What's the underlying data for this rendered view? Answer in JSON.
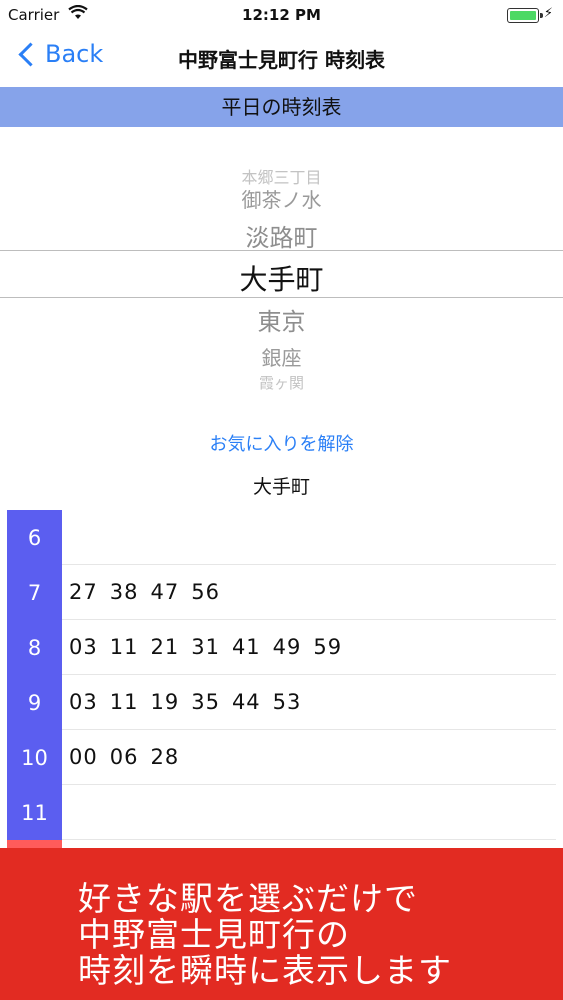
{
  "status_bar": {
    "carrier": "Carrier",
    "time": "12:12 PM",
    "wifi_icon": "wifi-icon",
    "battery_icon": "battery-icon",
    "charging_icon": "bolt-icon"
  },
  "nav": {
    "back_label": "Back",
    "title": "中野富士見町行 時刻表"
  },
  "section_header": "平日の時刻表",
  "picker": {
    "items": [
      "本郷三丁目",
      "御茶ノ水",
      "淡路町",
      "大手町",
      "東京",
      "銀座",
      "霞ヶ関"
    ],
    "selected": "大手町"
  },
  "favorite_label": "お気に入りを解除",
  "station_label": "大手町",
  "timetable": [
    {
      "hour": "6",
      "minutes": []
    },
    {
      "hour": "7",
      "minutes": [
        "27",
        "38",
        "47",
        "56"
      ]
    },
    {
      "hour": "8",
      "minutes": [
        "03",
        "11",
        "21",
        "31",
        "41",
        "49",
        "59"
      ]
    },
    {
      "hour": "9",
      "minutes": [
        "03",
        "11",
        "19",
        "35",
        "44",
        "53"
      ]
    },
    {
      "hour": "10",
      "minutes": [
        "00",
        "06",
        "28"
      ]
    },
    {
      "hour": "11",
      "minutes": []
    }
  ],
  "banner": {
    "line1": "好きな駅を選ぶだけで",
    "line2": "中野富士見町行の",
    "line3": "時刻を瞬時に表示します"
  },
  "colors": {
    "accent": "#2a7ff6",
    "section_header": "#86a3ea",
    "hour_cell": "#5b5ef0",
    "banner": "#e22b22"
  }
}
